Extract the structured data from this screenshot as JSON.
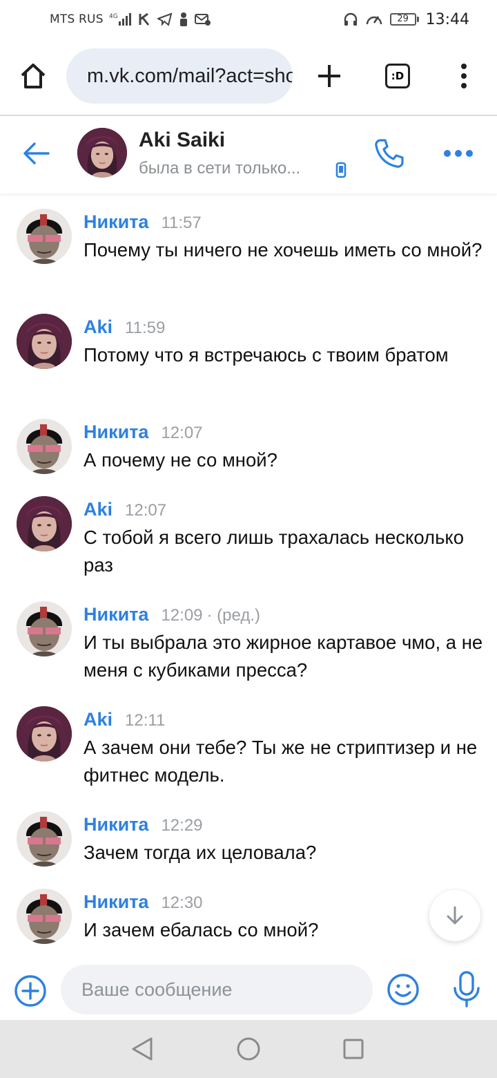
{
  "status_bar": {
    "carrier": "MTS RUS",
    "network": "4G",
    "battery": "29",
    "time": "13:44"
  },
  "browser": {
    "url": "m.vk.com/mail?act=show",
    "tabs_label": ":D"
  },
  "chat": {
    "contact_name": "Aki Saiki",
    "contact_status": "была в сети только..."
  },
  "messages": [
    {
      "author": "Никита",
      "time": "11:57",
      "edited": "",
      "text": "Почему ты ничего не хочешь иметь со мной?",
      "avatar": "nikita"
    },
    {
      "author": "Aki",
      "time": "11:59",
      "edited": "",
      "text": "Потому что я встречаюсь с твоим братом",
      "avatar": "aki"
    },
    {
      "author": "Никита",
      "time": "12:07",
      "edited": "",
      "text": "А почему не со мной?",
      "avatar": "nikita"
    },
    {
      "author": "Aki",
      "time": "12:07",
      "edited": "",
      "text": "С тобой я всего лишь трахалась несколько раз",
      "avatar": "aki"
    },
    {
      "author": "Никита",
      "time": "12:09",
      "edited": "· (ред.)",
      "text": "И ты выбрала это жирное картавое чмо, а не меня с кубиками пресса?",
      "avatar": "nikita"
    },
    {
      "author": "Aki",
      "time": "12:11",
      "edited": "",
      "text": "А зачем они тебе? Ты же не стриптизер и не фитнес модель.",
      "avatar": "aki"
    },
    {
      "author": "Никита",
      "time": "12:29",
      "edited": "",
      "text": "Зачем тогда их целовала?",
      "avatar": "nikita"
    },
    {
      "author": "Никита",
      "time": "12:30",
      "edited": "",
      "text": "И зачем ебалась со мной?",
      "avatar": "nikita"
    }
  ],
  "composer": {
    "placeholder": "Ваше сообщение"
  },
  "colors": {
    "accent": "#2d81e0",
    "meta": "#9a9ea4",
    "input_bg": "#f0f2f5",
    "nav_bg": "#e6e6e6"
  }
}
